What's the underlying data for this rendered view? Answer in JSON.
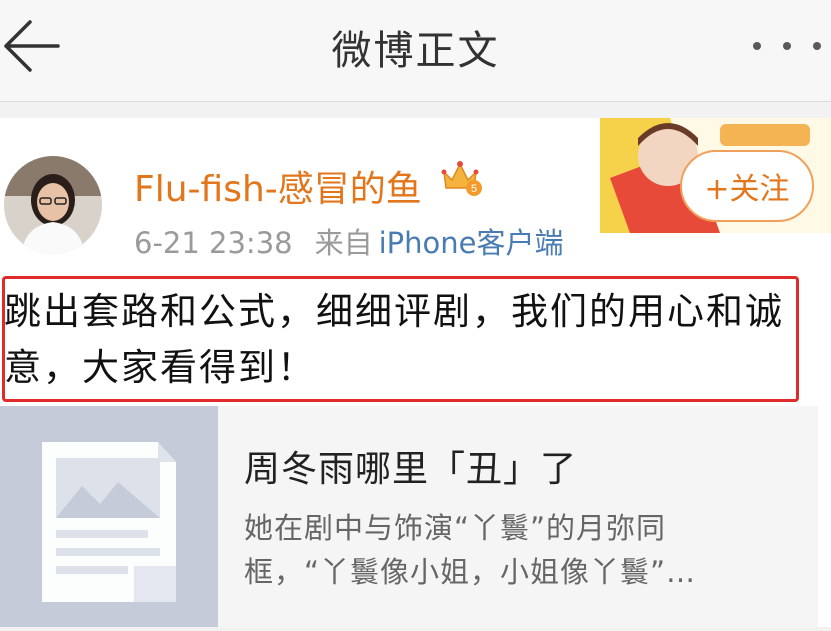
{
  "nav": {
    "title": "微博正文",
    "back_icon": "back-arrow-icon",
    "more_icon": "more-dots-icon"
  },
  "post": {
    "username": "Flu-fish-感冒的鱼",
    "badge_icon": "crown-vip-icon",
    "time": "6-21 23:38",
    "source_label": "来自",
    "source_client": "iPhone客户端",
    "follow_label": "+关注",
    "text": "跳出套路和公式，细细评剧，我们的用心和诚意，大家看得到！"
  },
  "link_card": {
    "title": "周冬雨哪里「丑」了",
    "description_line1": "她在剧中与饰演“丫鬟”的月弥同",
    "description_line2": "框，“丫鬟像小姐，小姐像丫鬟”…",
    "thumbnail_icon": "article-image-placeholder-icon"
  },
  "colors": {
    "username": "#e3761b",
    "client_link": "#4a7cb4",
    "highlight_border": "#e12a2a",
    "nav_bg": "#f7f7f7"
  }
}
